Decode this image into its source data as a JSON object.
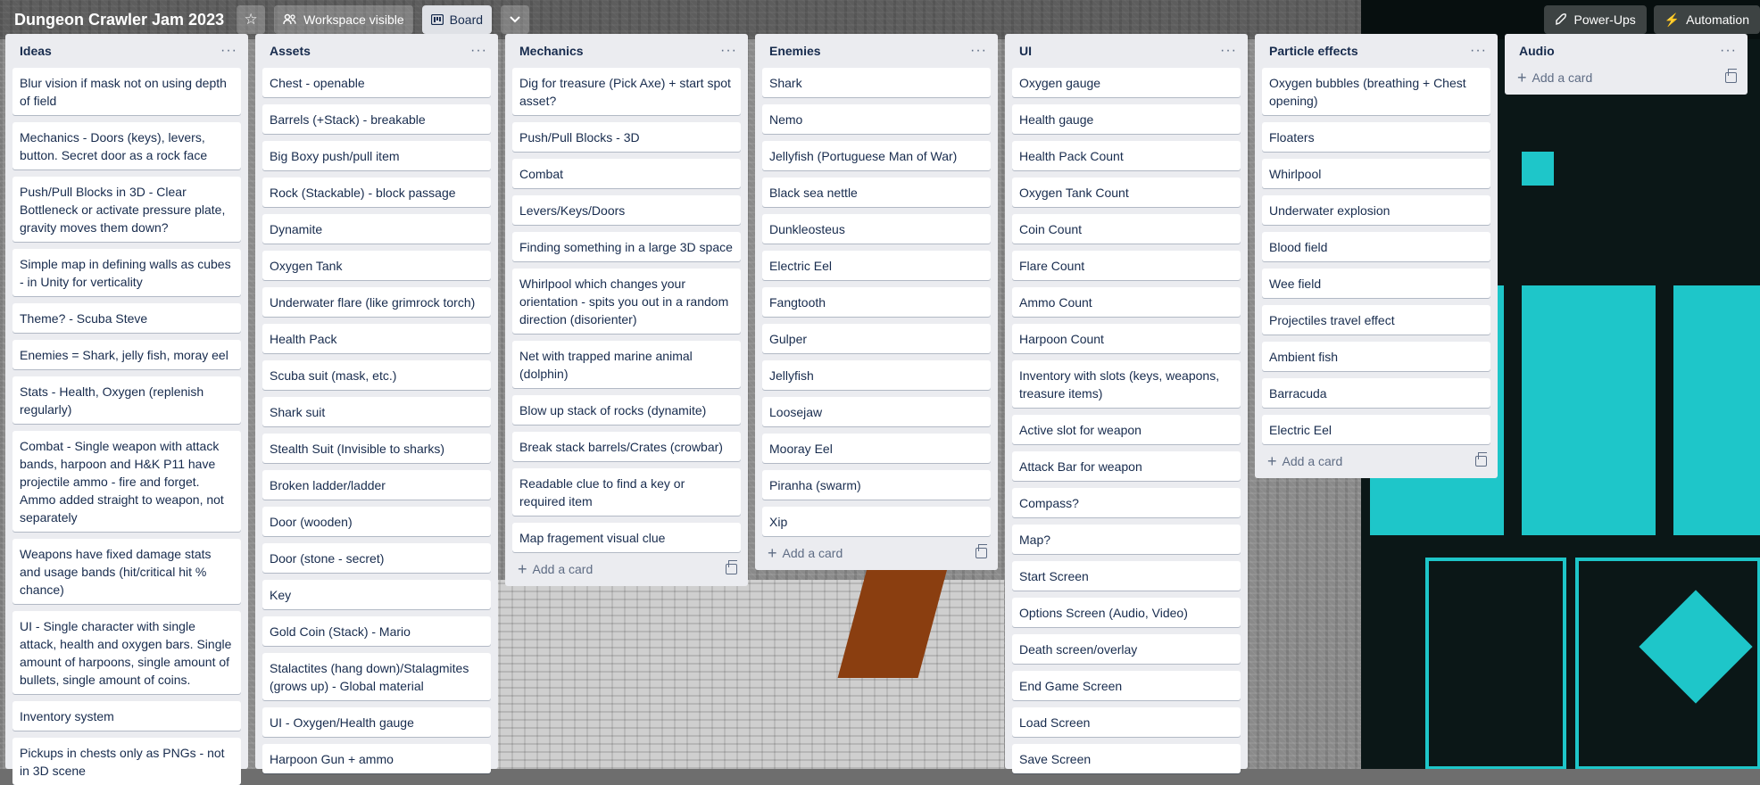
{
  "board": {
    "title": "Dungeon Crawler Jam 2023",
    "visibility_label": "Workspace visible",
    "view_label": "Board",
    "power_ups_label": "Power-Ups",
    "automation_label": "Automation"
  },
  "add_card_label": "Add a card",
  "lists": [
    {
      "title": "Ideas",
      "cards": [
        "Blur vision if mask not on using depth of field",
        "Mechanics - Doors (keys), levers, button. Secret door as a rock face",
        "Push/Pull Blocks in 3D - Clear Bottleneck or activate pressure plate, gravity moves them down?",
        "Simple map in defining walls as cubes - in Unity for verticality",
        "Theme? - Scuba Steve",
        "Enemies = Shark, jelly fish, moray eel",
        "Stats - Health, Oxygen (replenish regularly)",
        "Combat - Single weapon with attack bands, harpoon and H&K P11 have projectile ammo - fire and forget. Ammo added straight to weapon, not separately",
        "Weapons have fixed damage stats and usage bands (hit/critical hit % chance)",
        "UI - Single character with single attack, health and oxygen bars. Single amount of harpoons, single amount of bullets, single amount of coins.",
        "Inventory system",
        "Pickups in chests only as PNGs - not in 3D scene"
      ]
    },
    {
      "title": "Assets",
      "cards": [
        "Chest - openable",
        "Barrels (+Stack) - breakable",
        "Big Boxy push/pull item",
        "Rock (Stackable) - block passage",
        "Dynamite",
        "Oxygen Tank",
        "Underwater flare (like grimrock torch)",
        "Health Pack",
        "Scuba suit (mask, etc.)",
        "Shark suit",
        "Stealth Suit (Invisible to sharks)",
        "Broken ladder/ladder",
        "Door (wooden)",
        "Door (stone - secret)",
        "Key",
        "Gold Coin (Stack) - Mario",
        "Stalactites (hang down)/Stalagmites (grows up) - Global material",
        "UI - Oxygen/Health gauge",
        "Harpoon Gun + ammo"
      ]
    },
    {
      "title": "Mechanics",
      "cards": [
        "Dig for treasure (Pick Axe) + start spot asset?",
        "Push/Pull Blocks - 3D",
        "Combat",
        "Levers/Keys/Doors",
        "Finding something in a large 3D space",
        "Whirlpool which changes your orientation - spits you out in a random direction (disorienter)",
        "Net with trapped marine animal (dolphin)",
        "Blow up stack of rocks (dynamite)",
        "Break stack barrels/Crates (crowbar)",
        "Readable clue to find a key or required item",
        "Map fragement visual clue"
      ]
    },
    {
      "title": "Enemies",
      "cards": [
        "Shark",
        "Nemo",
        "Jellyfish (Portuguese Man of War)",
        "Black sea nettle",
        "Dunkleosteus",
        "Electric Eel",
        "Fangtooth",
        "Gulper",
        "Jellyfish",
        "Loosejaw",
        "Mooray Eel",
        "Piranha (swarm)",
        "Xip"
      ]
    },
    {
      "title": "UI",
      "cards": [
        "Oxygen gauge",
        "Health gauge",
        "Health Pack Count",
        "Oxygen Tank Count",
        "Coin Count",
        "Flare Count",
        "Ammo Count",
        "Harpoon Count",
        "Inventory with slots (keys, weapons, treasure items)",
        "Active slot for weapon",
        "Attack Bar for weapon",
        "Compass?",
        "Map?",
        "Start Screen",
        "Options Screen (Audio, Video)",
        "Death screen/overlay",
        "End Game Screen",
        "Load Screen",
        "Save Screen"
      ]
    },
    {
      "title": "Particle effects",
      "cards": [
        "Oxygen bubbles (breathing + Chest opening)",
        "Floaters",
        "Whirlpool",
        "Underwater explosion",
        "Blood field",
        "Wee field",
        "Projectiles travel effect",
        "Ambient fish",
        "Barracuda",
        "Electric Eel"
      ]
    },
    {
      "title": "Audio",
      "cards": []
    }
  ]
}
